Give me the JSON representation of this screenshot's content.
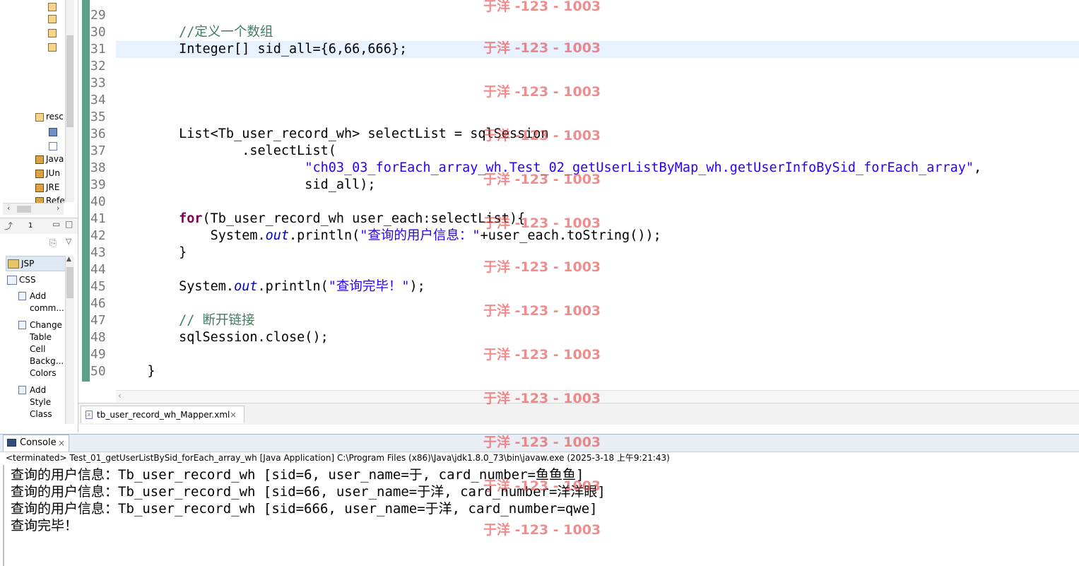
{
  "editor": {
    "lines": [
      {
        "num": "29",
        "html": ""
      },
      {
        "num": "30",
        "html": "        <span class=\"cmt\">//定义一个数组</span>"
      },
      {
        "num": "31",
        "html": "        Integer[] sid_all={6,66,666};"
      },
      {
        "num": "32",
        "html": ""
      },
      {
        "num": "33",
        "html": ""
      },
      {
        "num": "34",
        "html": ""
      },
      {
        "num": "35",
        "html": ""
      },
      {
        "num": "36",
        "html": "        List&lt;Tb_user_record_wh&gt; selectList = sqlSession"
      },
      {
        "num": "37",
        "html": "                .selectList("
      },
      {
        "num": "38",
        "html": "                        <span class=\"str\">\"ch03_03_forEach_array_wh.Test_02_getUserListByMap_wh.getUserInfoBySid_forEach_array\"</span>,"
      },
      {
        "num": "39",
        "html": "                        sid_all);"
      },
      {
        "num": "40",
        "html": ""
      },
      {
        "num": "41",
        "html": "        <span class=\"kw\">for</span>(Tb_user_record_wh user_each:selectList){"
      },
      {
        "num": "42",
        "html": "            System.<span class=\"fld\">out</span>.println(<span class=\"str\">\"查询的用户信息：\"</span>+user_each.toString());"
      },
      {
        "num": "43",
        "html": "        }"
      },
      {
        "num": "44",
        "html": ""
      },
      {
        "num": "45",
        "html": "        System.<span class=\"fld\">out</span>.println(<span class=\"str\">\"查询完毕！\"</span>);"
      },
      {
        "num": "46",
        "html": ""
      },
      {
        "num": "47",
        "html": "        <span class=\"cmt\">// 断开链接</span>"
      },
      {
        "num": "48",
        "html": "        sqlSession.close();"
      },
      {
        "num": "49",
        "html": ""
      },
      {
        "num": "50",
        "html": "    }"
      }
    ]
  },
  "left_tree": {
    "items": [
      {
        "label": "resc",
        "icon": "folder-icon"
      },
      {
        "label": "",
        "icon": "table-icon"
      },
      {
        "label": "",
        "icon": "xml-file-icon"
      },
      {
        "label": "Java",
        "icon": "library-icon"
      },
      {
        "label": "JUn",
        "icon": "library-icon"
      },
      {
        "label": "JRE",
        "icon": "library-icon"
      },
      {
        "label": "Refe",
        "icon": "library-icon"
      }
    ]
  },
  "snippets": {
    "panel_number": "1",
    "categories": [
      {
        "label": "JSP"
      },
      {
        "label": "CSS"
      }
    ],
    "items": [
      {
        "label": "Add comm..."
      },
      {
        "label": "Change Table Cell Backg... Colors"
      },
      {
        "label": "Add Style Class"
      }
    ]
  },
  "editor_tab": {
    "label": "tb_user_record_wh_Mapper.xml",
    "close": "×"
  },
  "console": {
    "tab_label": "Console",
    "close": "×",
    "status": "<terminated> Test_01_getUserListBySid_forEach_array_wh [Java Application] C:\\Program Files (x86)\\Java\\jdk1.8.0_73\\bin\\javaw.exe (2025-3-18 上午9:21:43)",
    "output": [
      "查询的用户信息：Tb_user_record_wh [sid=6, user_name=于, card_number=鱼鱼鱼]",
      "查询的用户信息：Tb_user_record_wh [sid=66, user_name=于洋, card_number=洋洋眼]",
      "查询的用户信息：Tb_user_record_wh [sid=666, user_name=于洋, card_number=qwe]",
      "查询完毕！"
    ]
  },
  "watermark": {
    "text": "于洋 -123 - 1003"
  },
  "colors": {
    "keyword": "#7f0055",
    "string": "#2a00ff",
    "comment": "#3f7f5f",
    "current_line": "#e8f2fe",
    "watermark": "#e64646"
  }
}
